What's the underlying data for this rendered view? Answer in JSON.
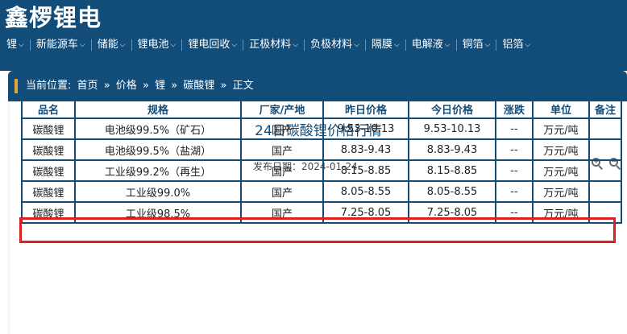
{
  "site": {
    "logo": "鑫椤锂电"
  },
  "nav": [
    {
      "label": "锂"
    },
    {
      "label": "新能源车"
    },
    {
      "label": "储能"
    },
    {
      "label": "锂电池"
    },
    {
      "label": "锂电回收"
    },
    {
      "label": "正极材料"
    },
    {
      "label": "负极材料"
    },
    {
      "label": "隔膜"
    },
    {
      "label": "电解液"
    },
    {
      "label": "铜箔"
    },
    {
      "label": "铝箔"
    }
  ],
  "breadcrumb": {
    "prefix": "当前位置:",
    "items": [
      "首页",
      "价格",
      "锂",
      "碳酸锂",
      "正文"
    ],
    "separator": "»"
  },
  "article": {
    "title": "24日碳酸锂价格行情",
    "date_label": "发布日期：",
    "date": "2024-01-24"
  },
  "table": {
    "headers": [
      "品名",
      "规格",
      "厂家/产地",
      "昨日价格",
      "今日价格",
      "涨跌",
      "单位",
      "备注"
    ],
    "rows": [
      [
        "碳酸锂",
        "电池级99.5%（矿石）",
        "国产",
        "9.53-10.13",
        "9.53-10.13",
        "--",
        "万元/吨",
        ""
      ],
      [
        "碳酸锂",
        "电池级99.5%（盐湖）",
        "国产",
        "8.83-9.43",
        "8.83-9.43",
        "--",
        "万元/吨",
        ""
      ],
      [
        "碳酸锂",
        "工业级99.2%（再生）",
        "国产",
        "8.15-8.85",
        "8.15-8.85",
        "--",
        "万元/吨",
        ""
      ],
      [
        "碳酸锂",
        "工业级99.0%",
        "国产",
        "8.05-8.55",
        "8.05-8.55",
        "--",
        "万元/吨",
        ""
      ],
      [
        "碳酸锂",
        "工业级98.5%",
        "国产",
        "7.25-8.05",
        "7.25-8.05",
        "--",
        "万元/吨",
        ""
      ]
    ]
  },
  "icons": {
    "zoom_in": "zoom-in-icon",
    "zoom_out": "zoom-out-icon"
  },
  "colors": {
    "brand": "#124c78",
    "highlight": "#e02020",
    "accent": "#e8a23a"
  }
}
